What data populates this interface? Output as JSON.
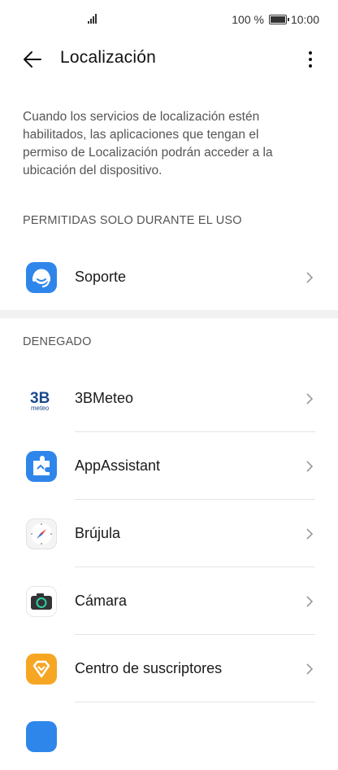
{
  "status_bar": {
    "battery_percent": "100 %",
    "time": "10:00"
  },
  "header": {
    "title": "Localización"
  },
  "description": "Cuando los servicios de localización estén habilitados, las aplicaciones que tengan el permiso de Localización podrán acceder a la ubicación del dispositivo.",
  "sections": {
    "allowed": {
      "header": "PERMITIDAS SOLO DURANTE EL USO",
      "apps": [
        {
          "label": "Soporte",
          "icon": "support-headset-icon"
        }
      ]
    },
    "denied": {
      "header": "DENEGADO",
      "apps": [
        {
          "label": "3BMeteo",
          "icon": "3bmeteo-logo-icon"
        },
        {
          "label": "AppAssistant",
          "icon": "puzzle-icon"
        },
        {
          "label": "Brújula",
          "icon": "compass-icon"
        },
        {
          "label": "Cámara",
          "icon": "camera-icon"
        },
        {
          "label": "Centro de suscriptores",
          "icon": "subscriber-center-icon"
        }
      ]
    }
  },
  "colors": {
    "accent_blue": "#2f86ea",
    "orange": "#f6a623",
    "divider": "#e4e4e4"
  }
}
